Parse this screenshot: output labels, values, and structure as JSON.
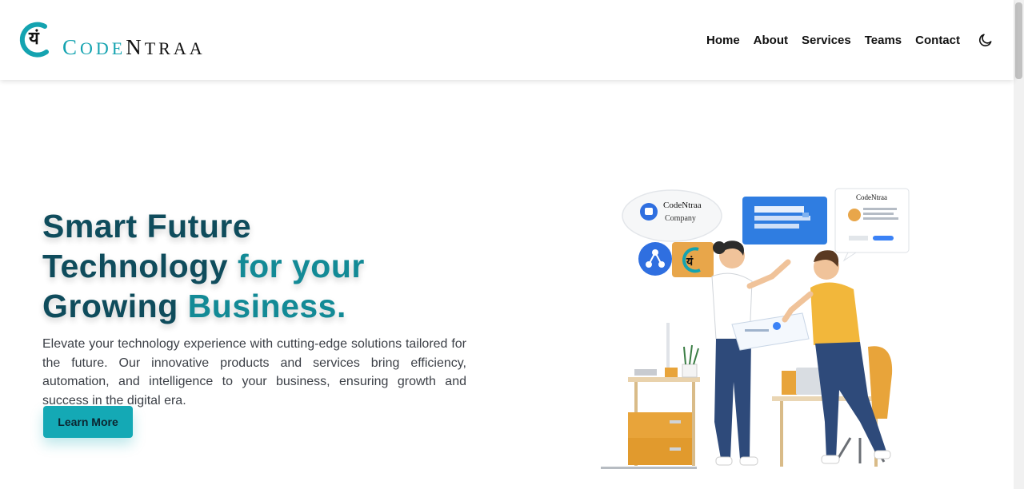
{
  "brand": {
    "logo_glyph": "यं",
    "name_part1_initial": "C",
    "name_part1_rest": "ODE",
    "name_part2_initial": "N",
    "name_part2_rest": "TRAA",
    "accent_color": "#14a3b0"
  },
  "nav": {
    "items": [
      {
        "label": "Home"
      },
      {
        "label": "About"
      },
      {
        "label": "Services"
      },
      {
        "label": "Teams"
      },
      {
        "label": "Contact"
      }
    ],
    "theme_icon": "moon-icon"
  },
  "hero": {
    "title_line1": "Smart Future",
    "title_line2_a": "Technology",
    "title_line2_b": "for your",
    "title_line3_a": "Growing",
    "title_line3_b": "Business.",
    "description": "Elevate your technology experience with cutting-edge solutions tailored for the future. Our innovative products and services bring efficiency, automation, and intelligence to your business, ensuring growth and success in the digital era.",
    "cta_label": "Learn More",
    "colors": {
      "dark": "#0f4c5c",
      "teal": "#138a96",
      "button": "#14a9b5"
    }
  },
  "illustration": {
    "bubble_title": "CodeNtraa",
    "bubble_subtitle": "Company",
    "card_title": "CodeNtraa",
    "icons": [
      "app-icon",
      "network-icon",
      "logo-badge-icon"
    ]
  }
}
